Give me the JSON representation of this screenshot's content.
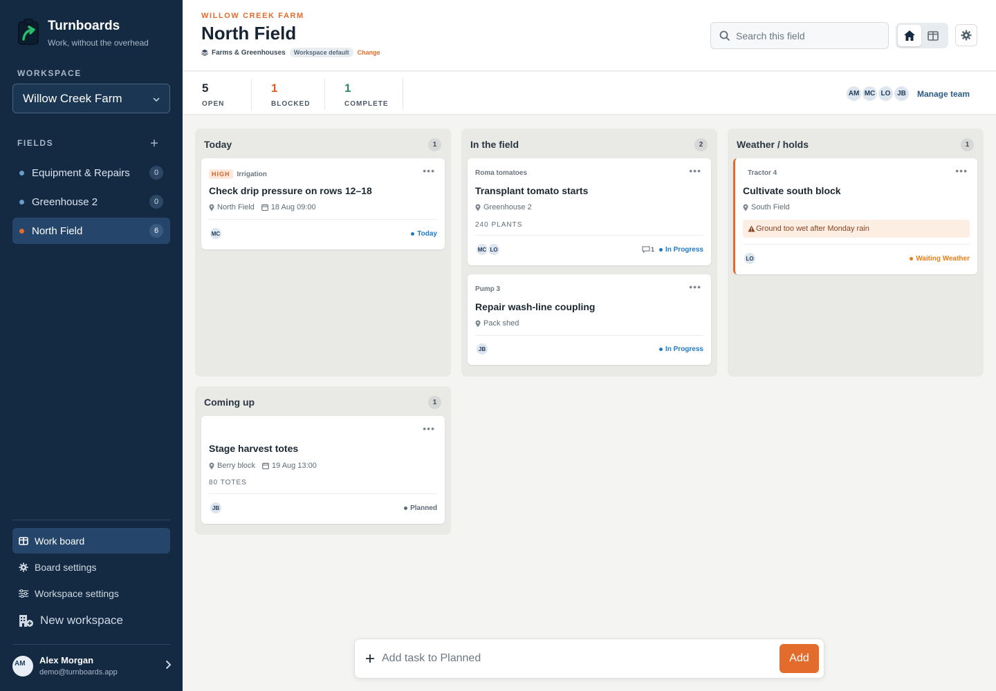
{
  "brand": {
    "name": "Turnboards",
    "tagline": "Work, without the overhead"
  },
  "sidebar": {
    "workspace_label": "WORKSPACE",
    "workspace_value": "Willow Creek Farm",
    "fields_label": "FIELDS",
    "fields": [
      {
        "label": "Equipment & Repairs",
        "count": "0"
      },
      {
        "label": "Greenhouse 2",
        "count": "0"
      },
      {
        "label": "North Field",
        "count": "6",
        "active": true
      }
    ],
    "nav": [
      {
        "label": "Work board",
        "icon": "board-icon",
        "active": true
      },
      {
        "label": "Board settings",
        "icon": "gear-icon"
      },
      {
        "label": "Workspace settings",
        "icon": "sliders-icon"
      },
      {
        "label": "New workspace",
        "icon": "building-plus-icon"
      }
    ],
    "user": {
      "initials": "AM",
      "name": "Alex Morgan",
      "email": "demo@turnboards.app"
    }
  },
  "header": {
    "kicker": "WILLOW CREEK FARM",
    "title": "North Field",
    "template": "Farms & Greenhouses",
    "badge": "Workspace default",
    "change": "Change",
    "search_placeholder": "Search this field"
  },
  "stats": [
    {
      "value": "5",
      "label": "OPEN"
    },
    {
      "value": "1",
      "label": "BLOCKED"
    },
    {
      "value": "1",
      "label": "COMPLETE"
    }
  ],
  "team": {
    "members": [
      "AM",
      "MC",
      "LO",
      "JB"
    ],
    "manage_label": "Manage team"
  },
  "columns": [
    {
      "title": "Today",
      "count": "1",
      "cards": [
        {
          "priority": "HIGH",
          "tag": "Irrigation",
          "title": "Check drip pressure on rows 12–18",
          "location": "North Field",
          "date": "18 Aug 09:00",
          "assignees": [
            "MC"
          ],
          "status": "Today"
        }
      ]
    },
    {
      "title": "In the field",
      "count": "2",
      "cards": [
        {
          "tag": "Roma tomatoes",
          "title": "Transplant tomato starts",
          "location": "Greenhouse 2",
          "quantity": "240 PLANTS",
          "assignees": [
            "MC",
            "LO"
          ],
          "comments": "1",
          "status": "In Progress"
        },
        {
          "tag": "Pump 3",
          "title": "Repair wash-line coupling",
          "location": "Pack shed",
          "assignees": [
            "JB"
          ],
          "status": "In Progress"
        }
      ]
    },
    {
      "title": "Weather / holds",
      "count": "1",
      "cards": [
        {
          "tag": "Tractor 4",
          "title": "Cultivate south block",
          "location": "South Field",
          "alert": "Ground too wet after Monday rain",
          "assignees": [
            "LO"
          ],
          "status": "Waiting Weather"
        }
      ]
    },
    {
      "title": "Coming up",
      "count": "1",
      "cards": [
        {
          "title": "Stage harvest totes",
          "location": "Berry block",
          "date": "19 Aug 13:00",
          "quantity": "80 TOTES",
          "assignees": [
            "JB"
          ],
          "status": "Planned"
        }
      ]
    }
  ],
  "add_bar": {
    "placeholder": "Add task to Planned",
    "button": "Add"
  },
  "colors": {
    "accent": "#e36b2c",
    "sidebar": "#132a42",
    "in_progress": "#1f7ac2",
    "planned": "#5d6a75",
    "waiting": "#e67e16"
  }
}
